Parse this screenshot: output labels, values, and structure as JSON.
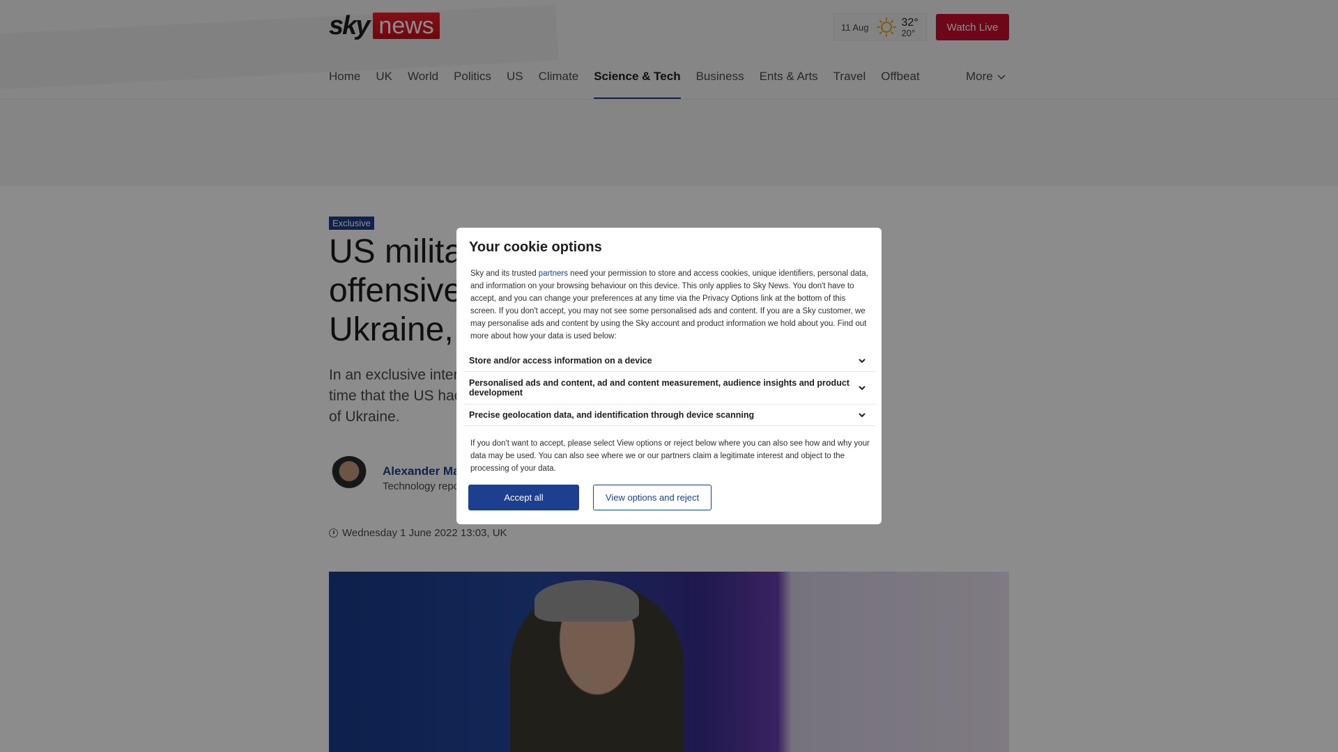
{
  "header": {
    "logo": {
      "sky": "sky",
      "news": "news"
    },
    "weather": {
      "date": "11 Aug",
      "high": "32°",
      "low": "20°",
      "icon": "sun-icon"
    },
    "watch_live": "Watch Live"
  },
  "nav": {
    "items": [
      {
        "label": "Home"
      },
      {
        "label": "UK"
      },
      {
        "label": "World"
      },
      {
        "label": "Politics"
      },
      {
        "label": "US"
      },
      {
        "label": "Climate"
      },
      {
        "label": "Science & Tech",
        "active": true
      },
      {
        "label": "Business"
      },
      {
        "label": "Ents & Arts"
      },
      {
        "label": "Travel"
      },
      {
        "label": "Offbeat"
      }
    ],
    "more": "More"
  },
  "article": {
    "badge": "Exclusive",
    "headline": "US militar  offensive  Ukraine, s",
    "headline_lines": [
      "US militar",
      "offensive",
      "Ukraine, s"
    ],
    "standfirst_lines": [
      "In an exclusive interv",
      "time that the US hac",
      "of Ukraine."
    ],
    "author_name": "Alexander Ma",
    "author_role": "Technology repo",
    "date": "Wednesday 1 June 2022 13:03, UK"
  },
  "cookie": {
    "title": "Your cookie options",
    "intro_before_link": "Sky and its trusted ",
    "intro_link": "partners",
    "intro_after_link": " need your permission to store and access cookies, unique identifiers, personal data, and information on your browsing behaviour on this device. This only applies to Sky News. You don't have to accept, and you can change your preferences at any time via the Privacy Options link at the bottom of this screen. If you don't accept, you may not see some personalised ads and content.  If you are a Sky customer, we may personalise ads and content by using the Sky account and product information we hold about you. Find out more about how your data is used below:",
    "sections": [
      {
        "label": "Store and/or access information on a device"
      },
      {
        "label": "Personalised ads and content, ad and content measurement, audience insights and product development"
      },
      {
        "label": "Precise geolocation data, and identification through device scanning"
      }
    ],
    "footer": "If you don't want to accept, please select View options or reject below where you can also see how and why your data may be used. You can also see where we or our partners claim a legitimate interest and object to the processing of your data.",
    "accept_label": "Accept all",
    "reject_label": "View options and reject"
  }
}
